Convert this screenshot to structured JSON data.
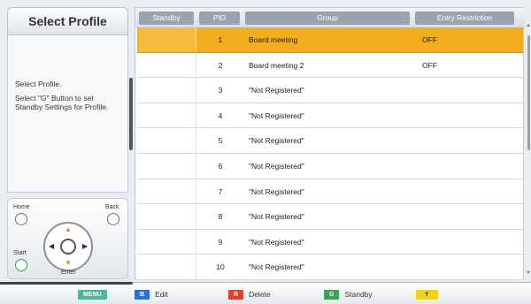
{
  "left_panel": {
    "title": "Select Profile",
    "help_line1": "Select Profile.",
    "help_line2": "Select \"G\" Button to set Standby Settings for Profile."
  },
  "remote": {
    "home": "Home",
    "back": "Back",
    "start": "Start",
    "enter": "Enter"
  },
  "table": {
    "headers": [
      "Standby",
      "PID",
      "Group",
      "Entry Restriction"
    ],
    "rows": [
      {
        "standby": "",
        "pid": "1",
        "group": "Board meeting",
        "entry": "OFF",
        "selected": true
      },
      {
        "standby": "",
        "pid": "2",
        "group": "Board meeting 2",
        "entry": "OFF",
        "selected": false
      },
      {
        "standby": "",
        "pid": "3",
        "group": "\"Not Registered\"",
        "entry": "",
        "selected": false
      },
      {
        "standby": "",
        "pid": "4",
        "group": "\"Not Registered\"",
        "entry": "",
        "selected": false
      },
      {
        "standby": "",
        "pid": "5",
        "group": "\"Not Registered\"",
        "entry": "",
        "selected": false
      },
      {
        "standby": "",
        "pid": "6",
        "group": "\"Not Registered\"",
        "entry": "",
        "selected": false
      },
      {
        "standby": "",
        "pid": "7",
        "group": "\"Not Registered\"",
        "entry": "",
        "selected": false
      },
      {
        "standby": "",
        "pid": "8",
        "group": "\"Not Registered\"",
        "entry": "",
        "selected": false
      },
      {
        "standby": "",
        "pid": "9",
        "group": "\"Not Registered\"",
        "entry": "",
        "selected": false
      },
      {
        "standby": "",
        "pid": "10",
        "group": "\"Not Registered\"",
        "entry": "",
        "selected": false
      }
    ]
  },
  "footer": {
    "menu_chip": "MENU",
    "b_chip": "B",
    "b_label": "Edit",
    "r_chip": "R",
    "r_label": "Delete",
    "g_chip": "G",
    "g_label": "Standby",
    "y_chip": "Y"
  },
  "colors": {
    "selected_row": "#f2ad1e",
    "menu_chip": "#4fb59a",
    "blue_chip": "#2a6fd6",
    "red_chip": "#e0412f",
    "green_chip": "#3aa35a",
    "yellow_chip": "#f3d21c"
  }
}
